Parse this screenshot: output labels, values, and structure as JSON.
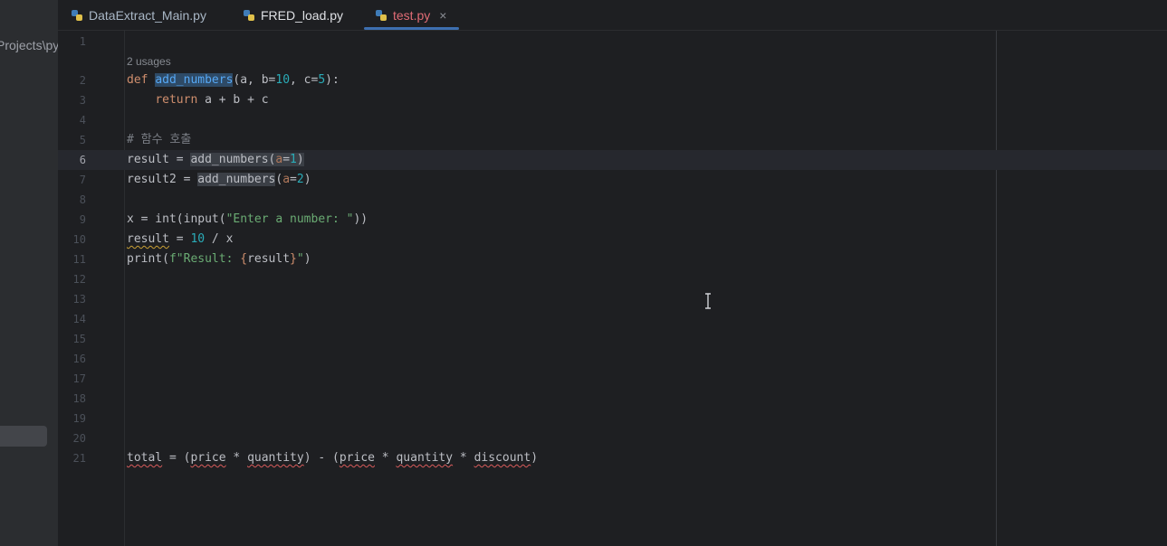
{
  "sidebar": {
    "path_fragment": "Projects\\py"
  },
  "tabs": [
    {
      "label": "DataExtract_Main.py",
      "active": false
    },
    {
      "label": "FRED_load.py",
      "active": false
    },
    {
      "label": "test.py",
      "active": true,
      "close": "×"
    }
  ],
  "editor": {
    "usages_hint": "2 usages",
    "current_line": 6,
    "line_numbers": [
      "1",
      "2",
      "3",
      "4",
      "5",
      "6",
      "7",
      "8",
      "9",
      "10",
      "11",
      "12",
      "13",
      "14",
      "15",
      "16",
      "17",
      "18",
      "19",
      "20",
      "21"
    ],
    "code": {
      "l2": {
        "kw": "def",
        "fn": "add_numbers",
        "rest1": "(a, b=",
        "n1": "10",
        "rest2": ", c=",
        "n2": "5",
        "rest3": "):"
      },
      "l3": {
        "indent": "    ",
        "kw": "return",
        "rest": " a + b + c"
      },
      "l5": {
        "comment": "# 함수 호출"
      },
      "l6": {
        "pre": "result = ",
        "call": "add_numbers",
        "open": "(",
        "param": "a",
        "eq": "=",
        "num": "1",
        "close": ")"
      },
      "l7": {
        "pre": "result2 = ",
        "call": "add_numbers",
        "open": "(",
        "param": "a",
        "eq": "=",
        "num": "2",
        "close": ")"
      },
      "l9": {
        "pre": "x = int(input(",
        "str": "\"Enter a number: \"",
        "close": "))"
      },
      "l10": {
        "var": "result",
        "mid": " = ",
        "num": "10",
        "rest": " / x"
      },
      "l11": {
        "pre": "print(",
        "str1": "f\"Result: ",
        "brace1": "{",
        "var": "result",
        "brace2": "}",
        "str2": "\"",
        "close": ")"
      },
      "l21": {
        "v1": "total",
        "t1": " = (",
        "v2": "price",
        "t2": " * ",
        "v3": "quantity",
        "t3": ") - (",
        "v4": "price",
        "t4": " * ",
        "v5": "quantity",
        "t5": " * ",
        "v6": "discount",
        "t6": ")"
      }
    }
  }
}
